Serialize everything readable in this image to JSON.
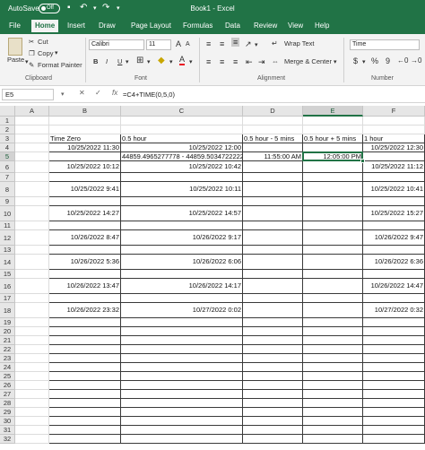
{
  "titlebar": {
    "autosave_label": "AutoSave",
    "autosave_state": "Off",
    "window_title": "Book1  -  Excel"
  },
  "tabs": [
    "File",
    "Home",
    "Insert",
    "Draw",
    "Page Layout",
    "Formulas",
    "Data",
    "Review",
    "View",
    "Help"
  ],
  "active_tab": "Home",
  "ribbon": {
    "clipboard": {
      "paste": "Paste",
      "cut": "Cut",
      "copy": "Copy",
      "format_painter": "Format Painter",
      "group": "Clipboard"
    },
    "font": {
      "name": "Calibri",
      "size": "11",
      "group": "Font",
      "bold": "B",
      "italic": "I",
      "underline": "U"
    },
    "alignment": {
      "wrap_text": "Wrap Text",
      "merge_center": "Merge & Center",
      "group": "Alignment"
    },
    "number": {
      "format": "Time",
      "currency": "$",
      "percent": "%",
      "comma": "9",
      "group": "Number"
    }
  },
  "formula_bar": {
    "name_box": "E5",
    "cancel": "✕",
    "enter": "✓",
    "fx": "fx",
    "formula": "=C4+TIME(0,5,0)"
  },
  "grid": {
    "columns": [
      "A",
      "B",
      "C",
      "D",
      "E",
      "F"
    ],
    "selected_column": "E",
    "selected_row": "5",
    "rows": [
      {
        "n": "1",
        "cells": [
          "",
          "",
          "",
          "",
          "",
          ""
        ]
      },
      {
        "n": "2",
        "cells": [
          "",
          "",
          "",
          "",
          "",
          ""
        ]
      },
      {
        "n": "3",
        "cells": [
          "",
          "Time Zero",
          "0.5 hour",
          "0.5 hour - 5 mins",
          "0.5 hour + 5 mins",
          "1 hour"
        ]
      },
      {
        "n": "4",
        "cells": [
          "",
          "10/25/2022 11:30",
          "10/25/2022 12:00",
          "",
          "",
          "10/25/2022 12:30"
        ]
      },
      {
        "n": "5",
        "cells": [
          "",
          "",
          "44859.4965277778 - 44859.50347222222",
          "11:55:00 AM",
          "12:05:00 PM",
          ""
        ]
      },
      {
        "n": "6",
        "cells": [
          "",
          "10/25/2022 10:12",
          "10/25/2022 10:42",
          "",
          "",
          "10/25/2022 11:12"
        ]
      },
      {
        "n": "7",
        "cells": [
          "",
          "",
          "",
          "",
          "",
          ""
        ]
      },
      {
        "n": "8",
        "cells": [
          "",
          "10/25/2022 9:41",
          "10/25/2022 10:11",
          "",
          "",
          "10/25/2022 10:41"
        ]
      },
      {
        "n": "9",
        "cells": [
          "",
          "",
          "",
          "",
          "",
          ""
        ]
      },
      {
        "n": "10",
        "cells": [
          "",
          "10/25/2022 14:27",
          "10/25/2022 14:57",
          "",
          "",
          "10/25/2022 15:27"
        ]
      },
      {
        "n": "11",
        "cells": [
          "",
          "",
          "",
          "",
          "",
          ""
        ]
      },
      {
        "n": "12",
        "cells": [
          "",
          "10/26/2022 8:47",
          "10/26/2022 9:17",
          "",
          "",
          "10/26/2022 9:47"
        ]
      },
      {
        "n": "13",
        "cells": [
          "",
          "",
          "",
          "",
          "",
          ""
        ]
      },
      {
        "n": "14",
        "cells": [
          "",
          "10/26/2022 5:36",
          "10/26/2022 6:06",
          "",
          "",
          "10/26/2022 6:36"
        ]
      },
      {
        "n": "15",
        "cells": [
          "",
          "",
          "",
          "",
          "",
          ""
        ]
      },
      {
        "n": "16",
        "cells": [
          "",
          "10/26/2022 13:47",
          "10/26/2022 14:17",
          "",
          "",
          "10/26/2022 14:47"
        ]
      },
      {
        "n": "17",
        "cells": [
          "",
          "",
          "",
          "",
          "",
          ""
        ]
      },
      {
        "n": "18",
        "cells": [
          "",
          "10/26/2022 23:32",
          "10/27/2022 0:02",
          "",
          "",
          "10/27/2022 0:32"
        ]
      },
      {
        "n": "19",
        "cells": [
          "",
          "",
          "",
          "",
          "",
          ""
        ]
      },
      {
        "n": "20",
        "cells": [
          "",
          "",
          "",
          "",
          "",
          ""
        ]
      },
      {
        "n": "21",
        "cells": [
          "",
          "",
          "",
          "",
          "",
          ""
        ]
      },
      {
        "n": "22",
        "cells": [
          "",
          "",
          "",
          "",
          "",
          ""
        ]
      },
      {
        "n": "23",
        "cells": [
          "",
          "",
          "",
          "",
          "",
          ""
        ]
      },
      {
        "n": "24",
        "cells": [
          "",
          "",
          "",
          "",
          "",
          ""
        ]
      },
      {
        "n": "25",
        "cells": [
          "",
          "",
          "",
          "",
          "",
          ""
        ]
      },
      {
        "n": "26",
        "cells": [
          "",
          "",
          "",
          "",
          "",
          ""
        ]
      },
      {
        "n": "27",
        "cells": [
          "",
          "",
          "",
          "",
          "",
          ""
        ]
      },
      {
        "n": "28",
        "cells": [
          "",
          "",
          "",
          "",
          "",
          ""
        ]
      },
      {
        "n": "29",
        "cells": [
          "",
          "",
          "",
          "",
          "",
          ""
        ]
      },
      {
        "n": "30",
        "cells": [
          "",
          "",
          "",
          "",
          "",
          ""
        ]
      },
      {
        "n": "31",
        "cells": [
          "",
          "",
          "",
          "",
          "",
          ""
        ]
      },
      {
        "n": "32",
        "cells": [
          "",
          "",
          "",
          "",
          "",
          ""
        ]
      }
    ]
  },
  "colors": {
    "excel_green": "#217346",
    "ribbon_bg": "#f3f3f3",
    "header_bg": "#e6e6e6",
    "font_color_bar": "#e81123"
  }
}
